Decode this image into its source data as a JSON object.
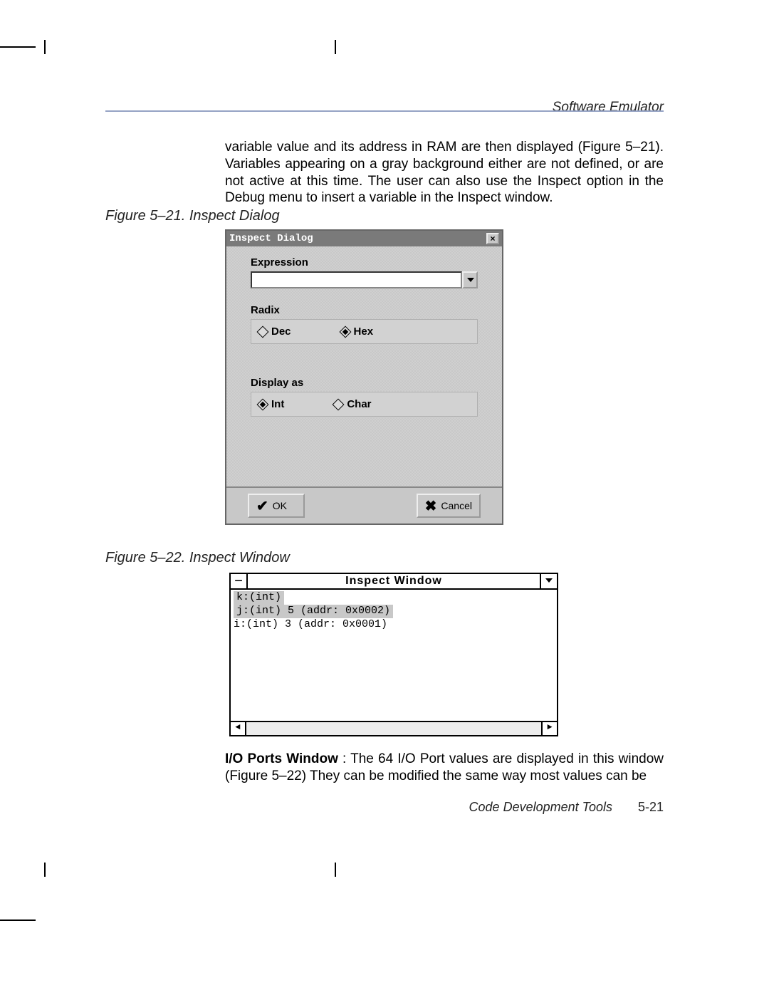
{
  "header": {
    "running": "Software Emulator"
  },
  "para1": "variable value and its address in RAM are then displayed (Figure 5–21). Variables appearing on a gray background either are not defined, or are not active at this time. The user can also use the Inspect option in the Debug menu to insert a variable in the Inspect window.",
  "fig1": {
    "caption": "Figure 5–21. Inspect Dialog"
  },
  "fig2": {
    "caption": "Figure 5–22. Inspect Window"
  },
  "dialog": {
    "title": "Inspect Dialog",
    "expression_label": "Expression",
    "expression_value": "",
    "radix_label": "Radix",
    "radix_options": {
      "dec": "Dec",
      "hex": "Hex"
    },
    "radix_selected": "hex",
    "display_label": "Display as",
    "display_options": {
      "int": "Int",
      "char": "Char"
    },
    "display_selected": "int",
    "ok_label": "OK",
    "cancel_label": "Cancel"
  },
  "inspectWindow": {
    "title": "Inspect Window",
    "rows": [
      "k:(int)",
      "j:(int) 5 (addr: 0x0002)",
      "i:(int) 3 (addr: 0x0001)"
    ]
  },
  "para2_bold": "I/O Ports Window",
  "para2_rest": " : The 64 I/O Port values are displayed in this window (Figure 5–22) They can be modified the same way most values can be",
  "footer": {
    "section": "Code Development Tools",
    "page": "5-21"
  }
}
